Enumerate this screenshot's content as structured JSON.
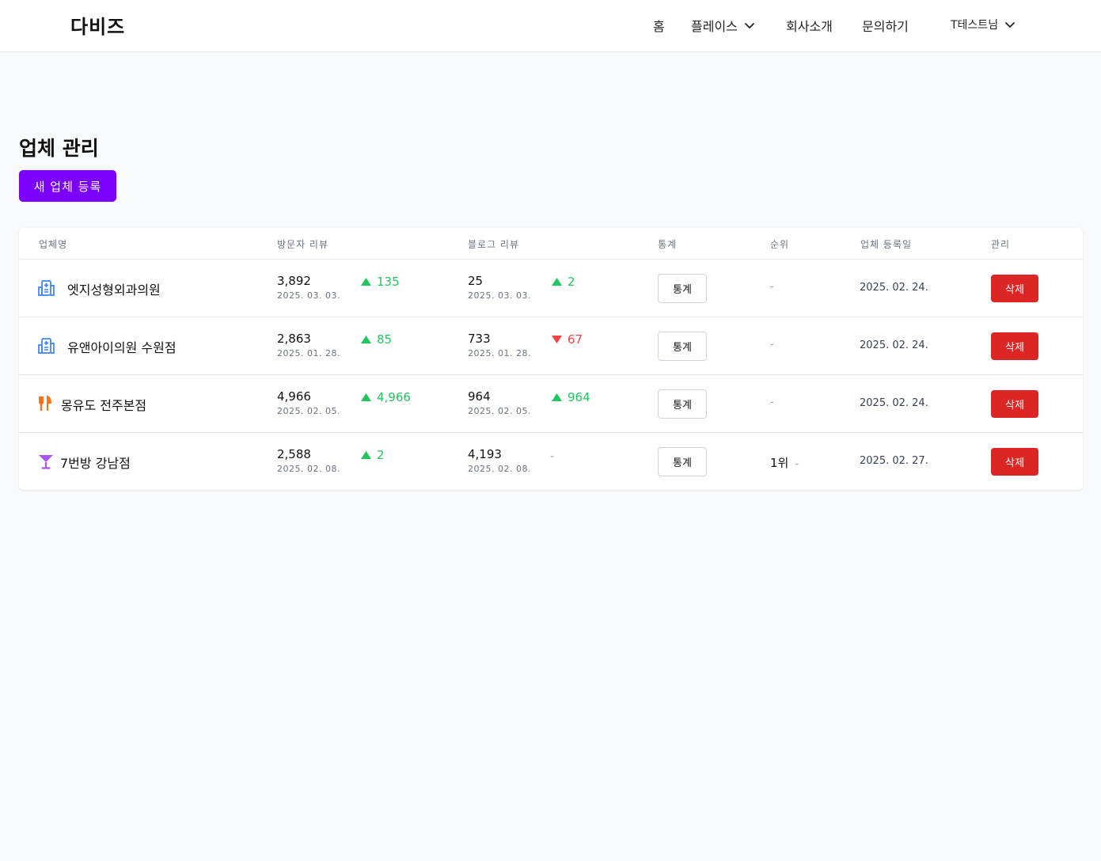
{
  "header": {
    "logo": "다비즈",
    "nav": {
      "home": "홈",
      "place": "플레이스",
      "about": "회사소개",
      "contact": "문의하기",
      "user": "T테스트님"
    }
  },
  "page": {
    "title": "업체 관리",
    "add_button": "새 업체 등록"
  },
  "table": {
    "headers": {
      "name": "업체명",
      "visitor_review": "방문자 리뷰",
      "blog_review": "블로그 리뷰",
      "stats": "통계",
      "rank": "순위",
      "reg_date": "업체 등록일",
      "manage": "관리"
    },
    "rows": [
      {
        "icon": "hospital-icon",
        "name": "엣지성형외과의원",
        "visitor_count": "3,892",
        "visitor_date": "2025. 03. 03.",
        "visitor_delta": "135",
        "visitor_dir": "up",
        "blog_count": "25",
        "blog_date": "2025. 03. 03.",
        "blog_delta": "2",
        "blog_dir": "up",
        "stats_label": "통계",
        "rank": "-",
        "rank_delta": "",
        "reg_date": "2025. 02. 24.",
        "delete_label": "삭제"
      },
      {
        "icon": "hospital-icon",
        "name": "유앤아이의원 수원점",
        "visitor_count": "2,863",
        "visitor_date": "2025. 01. 28.",
        "visitor_delta": "85",
        "visitor_dir": "up",
        "blog_count": "733",
        "blog_date": "2025. 01. 28.",
        "blog_delta": "67",
        "blog_dir": "down",
        "stats_label": "통계",
        "rank": "-",
        "rank_delta": "",
        "reg_date": "2025. 02. 24.",
        "delete_label": "삭제"
      },
      {
        "icon": "restaurant-icon",
        "name": "몽유도 전주본점",
        "visitor_count": "4,966",
        "visitor_date": "2025. 02. 05.",
        "visitor_delta": "4,966",
        "visitor_dir": "up",
        "blog_count": "964",
        "blog_date": "2025. 02. 05.",
        "blog_delta": "964",
        "blog_dir": "up",
        "stats_label": "통계",
        "rank": "-",
        "rank_delta": "",
        "reg_date": "2025. 02. 24.",
        "delete_label": "삭제"
      },
      {
        "icon": "cocktail-icon",
        "name": "7번방 강남점",
        "visitor_count": "2,588",
        "visitor_date": "2025. 02. 08.",
        "visitor_delta": "2",
        "visitor_dir": "up",
        "blog_count": "4,193",
        "blog_date": "2025. 02. 08.",
        "blog_delta": "-",
        "blog_dir": "none",
        "stats_label": "통계",
        "rank": "1위",
        "rank_delta": "-",
        "reg_date": "2025. 02. 27.",
        "delete_label": "삭제"
      }
    ]
  },
  "colors": {
    "primary": "#7c00ff",
    "danger": "#dc2626",
    "up": "#22c55e",
    "down": "#ef4444"
  }
}
